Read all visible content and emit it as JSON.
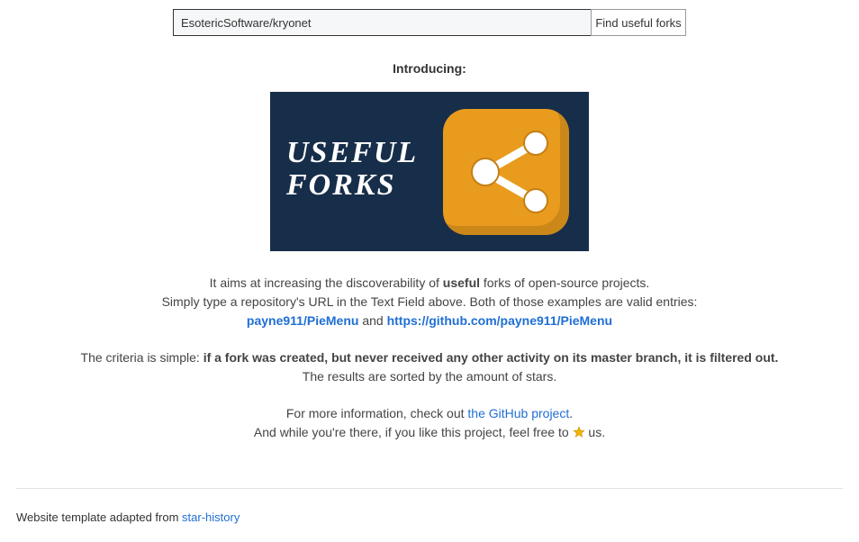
{
  "search": {
    "value": "EsotericSoftware/kryonet",
    "button_label": "Find useful forks"
  },
  "intro": {
    "heading": "Introducing:",
    "logo_line1": "USEFUL",
    "logo_line2": "FORKS"
  },
  "desc": {
    "line1_a": "It aims at increasing the discoverability of ",
    "line1_b": "useful",
    "line1_c": " forks of open-source projects.",
    "line2": "Simply type a repository's URL in the Text Field above. Both of those examples are valid entries:",
    "example1": "payne911/PieMenu",
    "and": " and ",
    "example2": "https://github.com/payne911/PieMenu"
  },
  "criteria": {
    "prefix": "The criteria is simple: ",
    "bold": "if a fork was created, but never received any other activity on its master branch, it is filtered out.",
    "results": "The results are sorted by the amount of stars."
  },
  "moreinfo": {
    "prefix": "For more information, check out ",
    "link": "the GitHub project",
    "suffix": ".",
    "star_prefix": "And while you're there, if you like this project, feel free to ",
    "star_suffix": " us."
  },
  "footer": {
    "prefix": "Website template adapted from ",
    "link": "star-history"
  }
}
